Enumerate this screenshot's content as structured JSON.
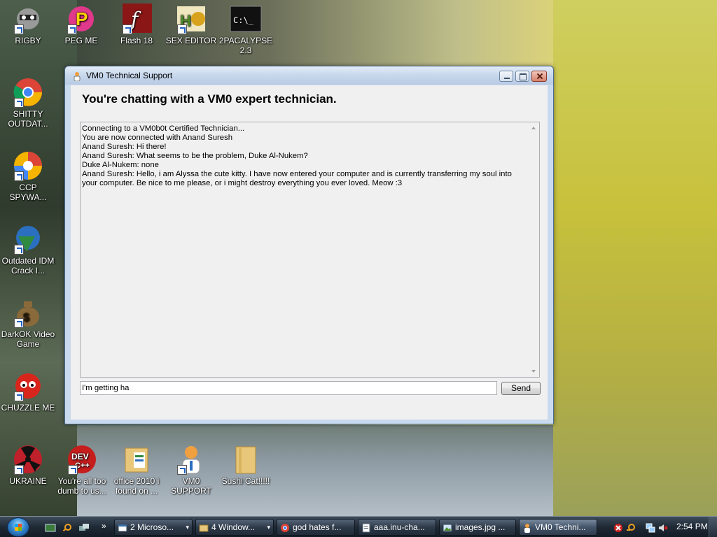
{
  "desktop": {
    "icons": [
      {
        "label": "RIGBY",
        "icon": "raccoon-icon",
        "color": "#8c8c8c"
      },
      {
        "label": "PEG ME",
        "icon": "peg-icon",
        "color": "#e0388a"
      },
      {
        "label": "Flash 18",
        "icon": "flash-icon",
        "color": "#8b1616"
      },
      {
        "label": "SEX EDITOR",
        "icon": "hex-editor-icon",
        "color": "#d8a21c"
      },
      {
        "label": "2PACALYPSE 2.3",
        "icon": "terminal-icon",
        "color": "#111111"
      },
      {
        "label": "SHITTY OUTDAT...",
        "icon": "chrome-icon",
        "color": "#db4437"
      },
      {
        "label": "CCP SPYWA...",
        "icon": "pinwheel-icon",
        "color": "#f4b400"
      },
      {
        "label": "Outdated IDM Crack I...",
        "icon": "globe-download-icon",
        "color": "#2e8b3f"
      },
      {
        "label": "DarkOK Video Game",
        "icon": "money-bag-icon",
        "color": "#8a6a3a"
      },
      {
        "label": "CHUZZLE ME",
        "icon": "chuzzle-icon",
        "color": "#d9261c"
      },
      {
        "label": "UKRAINE",
        "icon": "radiation-icon",
        "color": "#c0202a"
      },
      {
        "label": "You're all too dumb to us...",
        "icon": "devcpp-icon",
        "color": "#c61d1d"
      },
      {
        "label": "office 2010 i found on ...",
        "icon": "folder-icon",
        "color": "#e8c77a"
      },
      {
        "label": "VM0 SUPPORT",
        "icon": "technician-icon",
        "color": "#f0a040"
      },
      {
        "label": "Sushi Cat!!!!!",
        "icon": "folder-icon",
        "color": "#e8c77a"
      }
    ]
  },
  "window": {
    "title": "VM0 Technical Support",
    "heading": "You're chatting with a VM0 expert technician.",
    "chat_lines": [
      "Connecting to a VM0b0t Certified Technician...",
      "You are now connected with Anand Suresh",
      "Anand Suresh: Hi there!",
      "Anand Suresh: What seems to be the problem, Duke Al-Nukem?",
      "Duke Al-Nukem: none",
      "Anand Suresh: Hello, i am Alyssa the cute kitty. I have now entered your computer and is currently transferring my soul into your computer. Be nice to me please, or i might destroy everything you ever loved. Meow :3"
    ],
    "input_value": "I'm getting ha",
    "send_label": "Send"
  },
  "taskbar": {
    "overflow_chevron": "»",
    "tasks": [
      {
        "label": "2 Microso...",
        "icon": "window-icon",
        "dropdown": "▾"
      },
      {
        "label": "4 Window...",
        "icon": "folder-icon",
        "dropdown": "▾"
      },
      {
        "label": "god hates f...",
        "icon": "chrome-icon"
      },
      {
        "label": "aaa.inu-cha...",
        "icon": "document-icon"
      },
      {
        "label": "images.jpg ...",
        "icon": "image-icon"
      },
      {
        "label": "VM0 Techni...",
        "icon": "technician-icon"
      }
    ],
    "clock": "2:54 PM"
  }
}
